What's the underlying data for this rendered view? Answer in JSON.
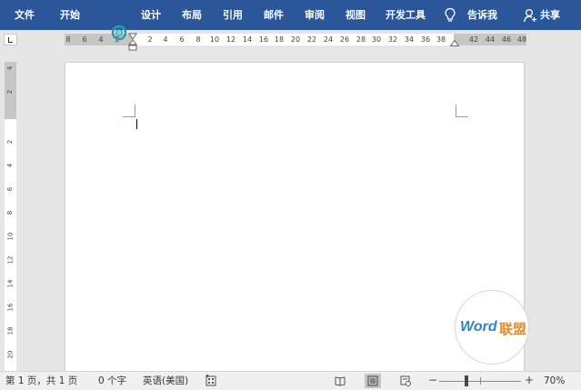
{
  "ribbon": {
    "tabs": [
      {
        "key": "file",
        "label": "文件"
      },
      {
        "key": "home",
        "label": "开始"
      },
      {
        "key": "design",
        "label": "设计"
      },
      {
        "key": "layout",
        "label": "布局"
      },
      {
        "key": "references",
        "label": "引用"
      },
      {
        "key": "mailings",
        "label": "邮件"
      },
      {
        "key": "review",
        "label": "审阅"
      },
      {
        "key": "view",
        "label": "视图"
      },
      {
        "key": "developer",
        "label": "开发工具"
      }
    ],
    "tell_me": "告诉我",
    "share": "共享",
    "bg_color": "#2b579a"
  },
  "ruler": {
    "h_numbers": [
      "8",
      "6",
      "4",
      "2",
      "2",
      "4",
      "6",
      "8",
      "10",
      "12",
      "14",
      "16",
      "18",
      "20",
      "22",
      "24",
      "26",
      "28",
      "30",
      "32",
      "34",
      "36",
      "38",
      "42",
      "44",
      "46",
      "48"
    ],
    "v_numbers": [
      "4",
      "2",
      "2",
      "4",
      "6",
      "8",
      "10",
      "12",
      "14",
      "16",
      "18",
      "20"
    ]
  },
  "watermark": {
    "word": "Word",
    "cn": "联盟"
  },
  "statusbar": {
    "page_info": "第 1 页，共 1 页",
    "word_count": "0 个字",
    "language": "英语(美国)",
    "zoom": "70%",
    "zoom_minus": "−",
    "zoom_plus": "+"
  }
}
